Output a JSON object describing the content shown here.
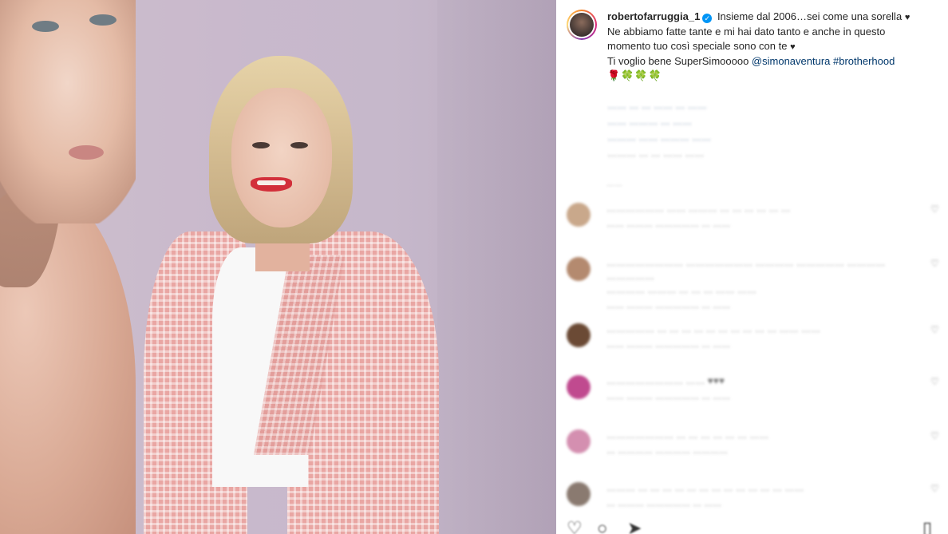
{
  "post": {
    "author": "robertofarruggia_1",
    "verified_glyph": "✓",
    "caption_line1": "Insieme dal 2006…sei come una sorella",
    "caption_heart": "♥",
    "caption_line2": "Ne abbiamo fatte tante e mi hai dato tanto e anche in questo",
    "caption_line3": "momento tuo così speciale sono con te",
    "caption_line4": "Ti voglio bene SuperSimooooo",
    "mention": "@simonaventura",
    "hashtag": "#brotherhood",
    "emojis": "🌹🍀🍀🍀"
  },
  "post_meta": {
    "link_1": "…… … … …… … ……",
    "link_2": "…… ……… … ……",
    "link_3": "……… …… ……… ……",
    "timestamp": "……… … … …… ……"
  },
  "comments": {
    "divider": "……",
    "items": [
      {
        "text": "……………… …… ……… … … … … … …",
        "sub": "…… ……… …………… … ……",
        "avatar_color": "#c9a88b"
      },
      {
        "text": "…………………… ………………… ………… …………… ………… ……………",
        "text2": "………… ……… … … … …… ……",
        "sub": "…… ……… …………… … ……",
        "avatar_color": "#b48a6f"
      },
      {
        "text": "…………… … … … … … … … … … … …… ……",
        "sub": "…… ……… …………… … ……",
        "avatar_color": "#6b4a35"
      },
      {
        "text": "…………………… …… ♥♥♥",
        "sub": "…… ……… …………… … ……",
        "avatar_color": "#c04a8f"
      },
      {
        "text": "………………… … … … … … … ……",
        "sub": "… ………… ………… …………",
        "avatar_color": "#d48fb0"
      },
      {
        "text": "……… … … … … … … … … … … … … ……",
        "sub": "… ……… …………… … ……",
        "avatar_color": "#8a7a70"
      }
    ]
  },
  "actions": {
    "like_icon": "heart-icon",
    "comment_icon": "comment-icon",
    "share_icon": "share-icon",
    "save_icon": "bookmark-icon"
  },
  "colors": {
    "link": "#00376b",
    "verified": "#0095f6",
    "text": "#262626"
  }
}
